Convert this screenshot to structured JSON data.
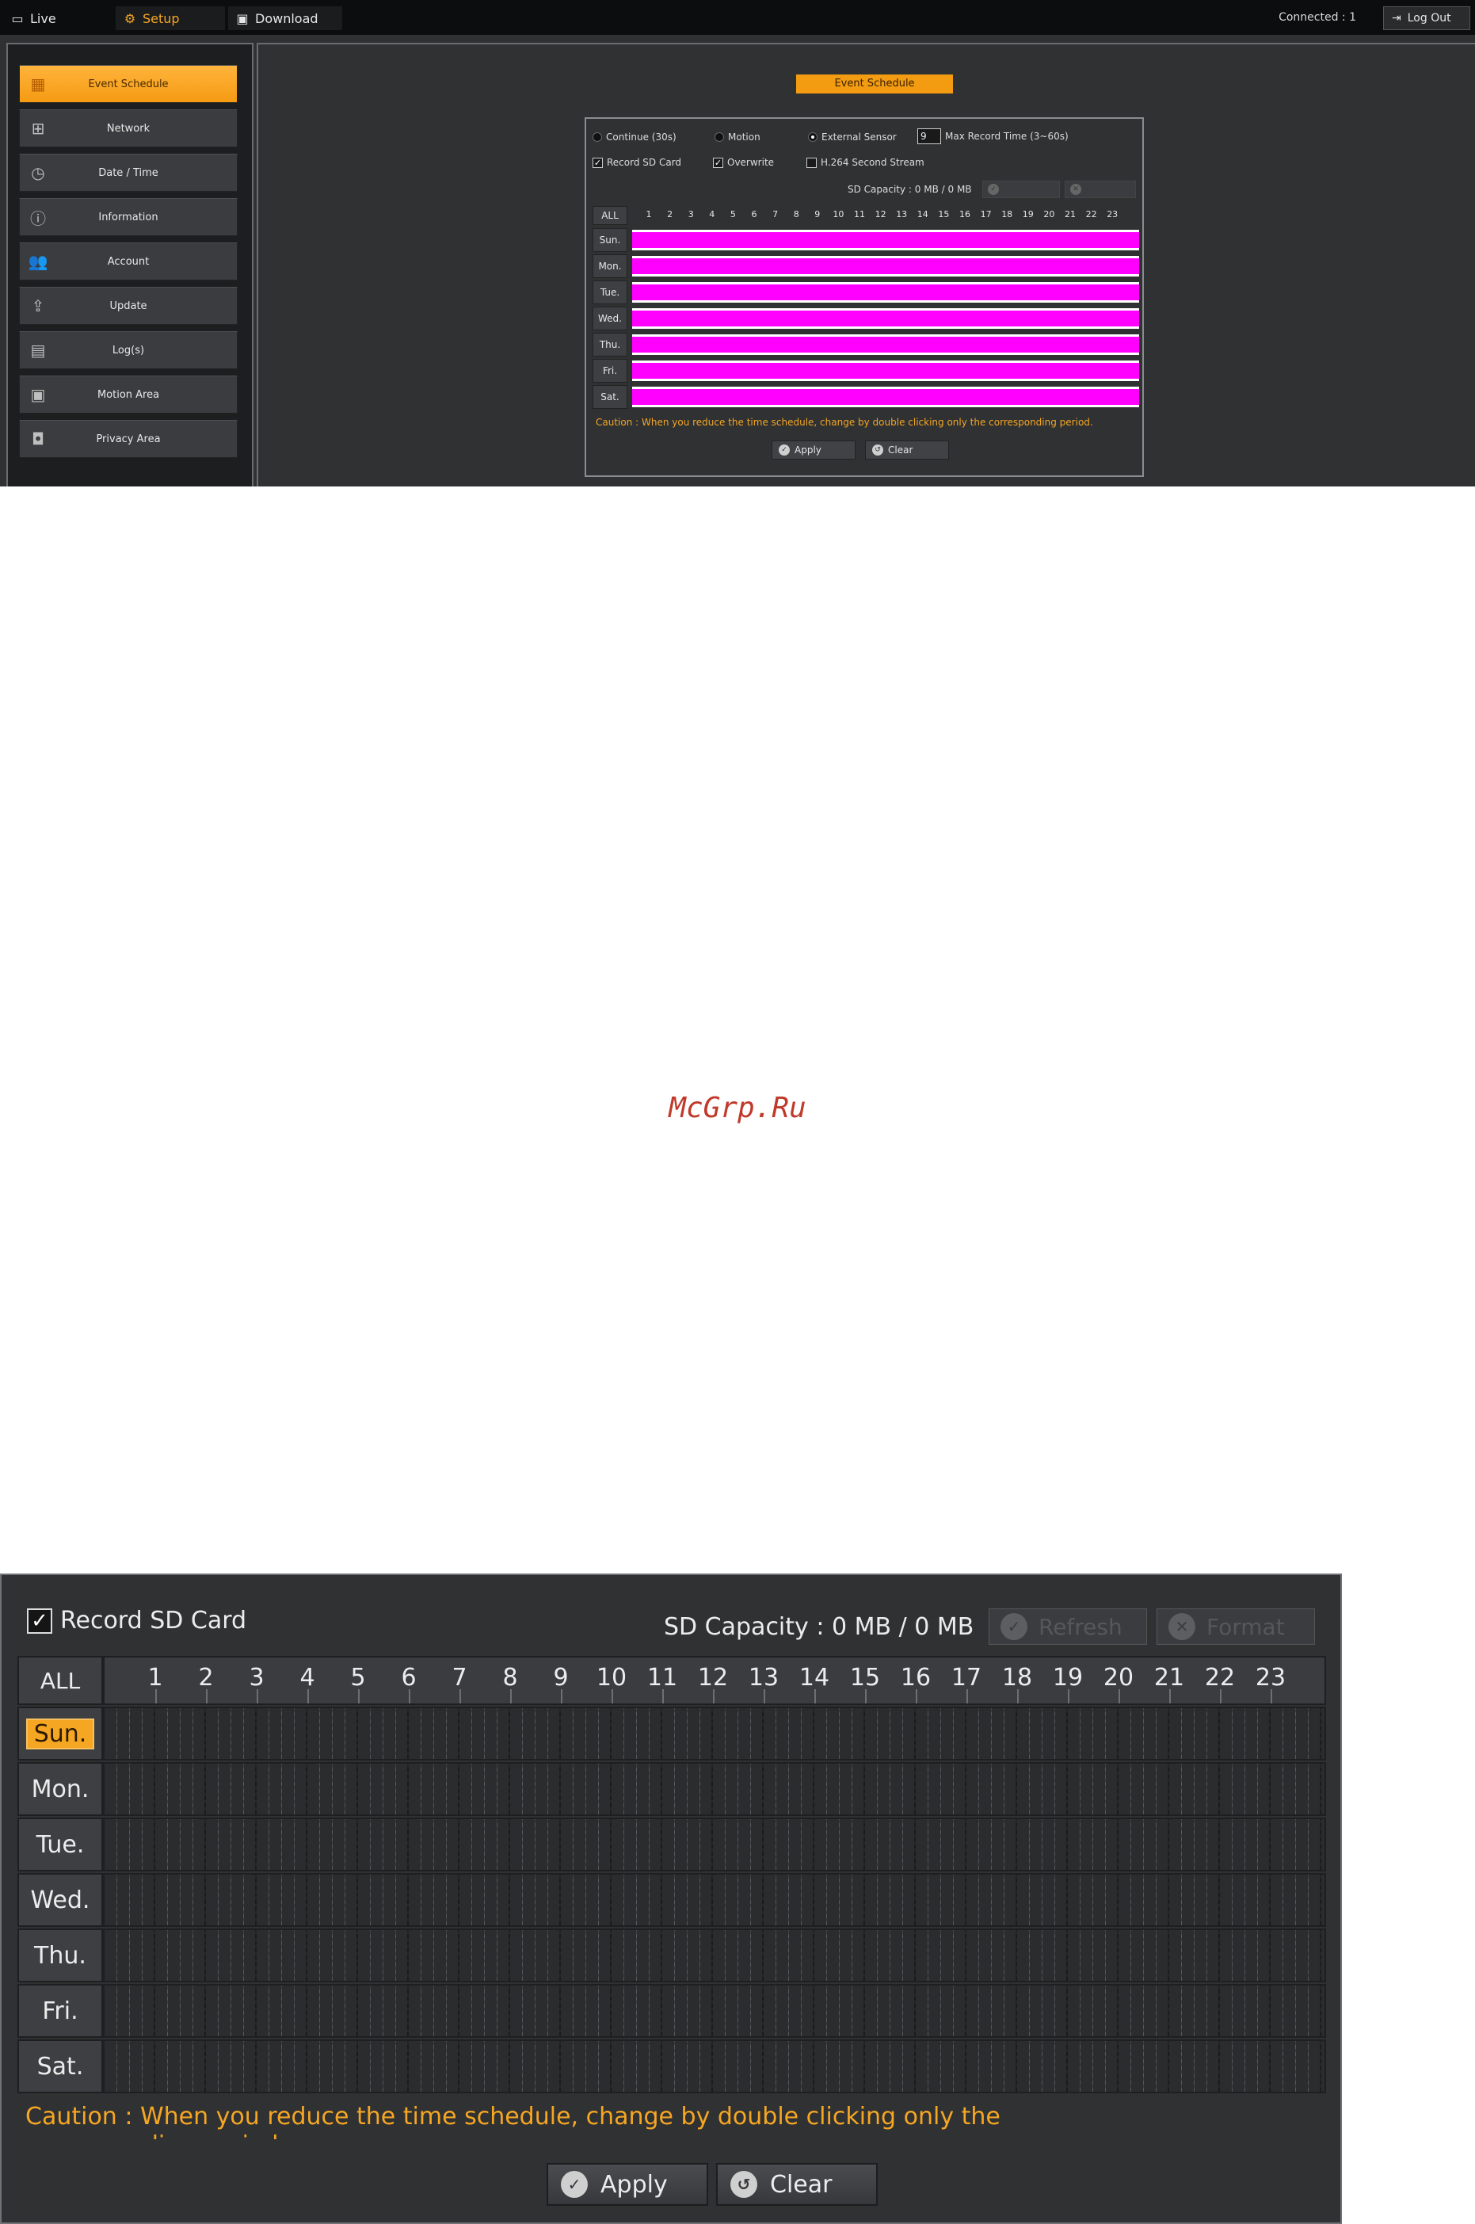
{
  "topbar": {
    "tabs": [
      {
        "label": "Live",
        "icon": "monitor-icon"
      },
      {
        "label": "Setup",
        "icon": "gear-icon"
      },
      {
        "label": "Download",
        "icon": "download-icon"
      }
    ],
    "connected": "Connected : 1",
    "logout": "Log Out"
  },
  "sidebar": {
    "items": [
      {
        "label": "Event Schedule",
        "icon": "calendar-icon"
      },
      {
        "label": "Network",
        "icon": "network-icon"
      },
      {
        "label": "Date / Time",
        "icon": "clock-icon"
      },
      {
        "label": "Information",
        "icon": "info-icon"
      },
      {
        "label": "Account",
        "icon": "users-icon"
      },
      {
        "label": "Update",
        "icon": "upload-icon"
      },
      {
        "label": "Log(s)",
        "icon": "log-icon"
      },
      {
        "label": "Motion Area",
        "icon": "motion-icon"
      },
      {
        "label": "Privacy Area",
        "icon": "privacy-icon"
      }
    ]
  },
  "schedule": {
    "title": "Event Schedule",
    "mode_continue": "Continue (30s)",
    "mode_motion": "Motion",
    "mode_sensor": "External Sensor",
    "max_record_value": "9",
    "max_record_label": "Max Record Time (3~60s)",
    "record_sd": "Record SD Card",
    "overwrite": "Overwrite",
    "h264": "H.264 Second Stream",
    "sd_capacity": "SD Capacity : 0 MB / 0 MB",
    "refresh": "Refresh",
    "format": "Format",
    "all": "ALL",
    "hours": [
      "1",
      "2",
      "3",
      "4",
      "5",
      "6",
      "7",
      "8",
      "9",
      "10",
      "11",
      "12",
      "13",
      "14",
      "15",
      "16",
      "17",
      "18",
      "19",
      "20",
      "21",
      "22",
      "23"
    ],
    "days": [
      "Sun.",
      "Mon.",
      "Tue.",
      "Wed.",
      "Thu.",
      "Fri.",
      "Sat."
    ],
    "caution": "Caution : When you reduce the time schedule, change by double clicking only the corresponding period.",
    "apply": "Apply",
    "clear": "Clear",
    "schedule_color": "#ff00ff"
  },
  "watermark": "McGrp.Ru",
  "zoom": {
    "record_sd": "Record SD Card",
    "sd_capacity": "SD Capacity : 0 MB / 0 MB",
    "refresh": "Refresh",
    "format": "Format",
    "all": "ALL",
    "selected_day": "Sun.",
    "caution": "Caution : When you reduce the time schedule, change by double clicking only the corresponding period.",
    "apply": "Apply",
    "clear": "Clear"
  },
  "colors": {
    "accent": "#f5a623",
    "background": "#2f3133",
    "caution": "#f5a623"
  }
}
